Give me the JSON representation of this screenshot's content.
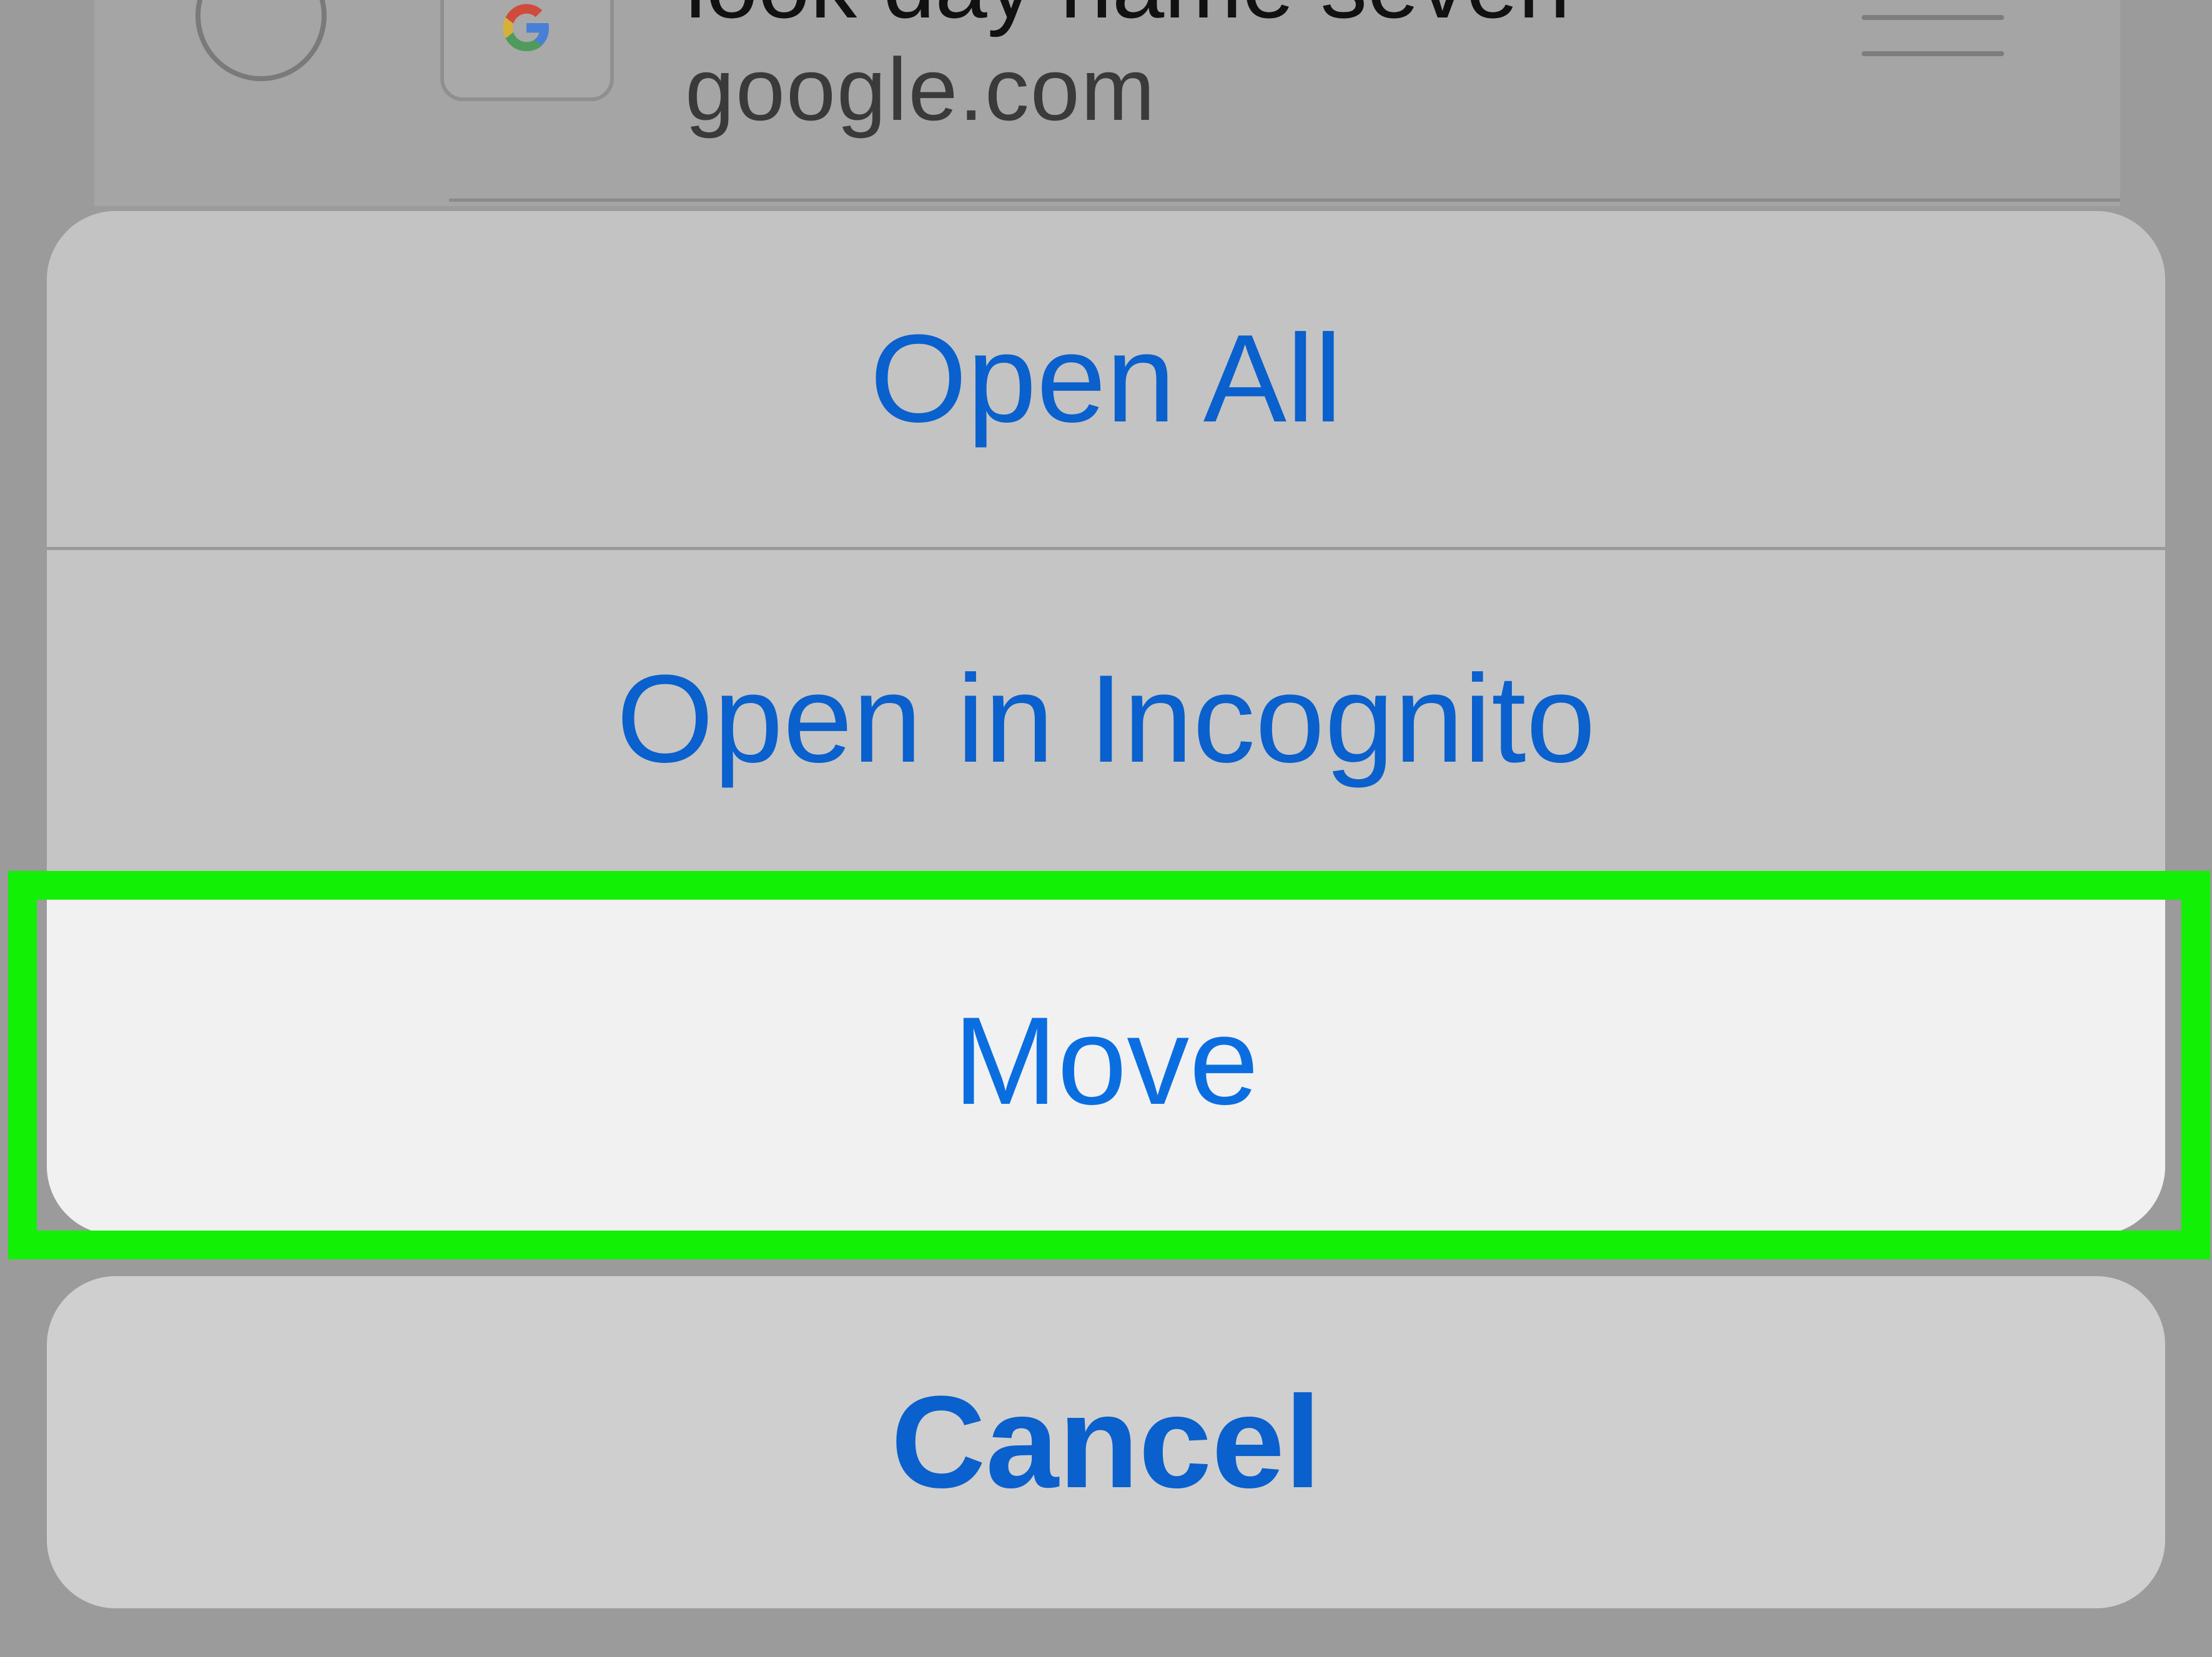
{
  "background_list": {
    "item": {
      "title": "look day name seven",
      "url": "google.com",
      "favicon": "google-g-icon"
    }
  },
  "action_sheet": {
    "actions": [
      {
        "label": "Open All"
      },
      {
        "label": "Open in Incognito"
      },
      {
        "label": "Move"
      }
    ],
    "cancel_label": "Cancel"
  },
  "colors": {
    "action_text": "#0a60cc",
    "highlight": "#12f006",
    "overlay": "#9b9b9b"
  }
}
